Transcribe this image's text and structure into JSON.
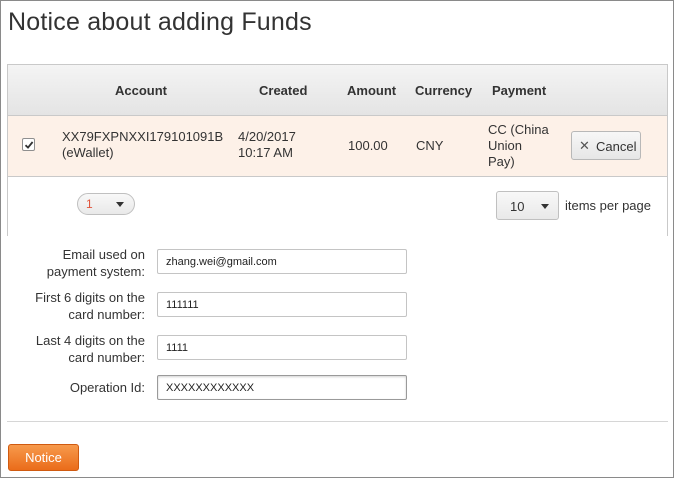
{
  "page": {
    "title": "Notice about adding Funds"
  },
  "grid": {
    "columns": [
      "Account",
      "Created",
      "Amount",
      "Currency",
      "Payment"
    ],
    "rows": [
      {
        "checked": true,
        "account_line1": "XX79FXPNXXI179101091B",
        "account_line2": "(eWallet)",
        "created_line1": "4/20/2017",
        "created_line2": "10:17 AM",
        "amount": "100.00",
        "currency": "CNY",
        "payment_line1": "CC (China",
        "payment_line2": "Union",
        "payment_line3": "Pay)",
        "action_label": "Cancel",
        "action_icon": "close-icon"
      }
    ],
    "pager": {
      "current_page": "1",
      "page_size": "10",
      "page_size_label": "items per page"
    }
  },
  "form": {
    "email": {
      "label_line1": "Email used on",
      "label_line2": "payment system:",
      "value": "zhang.wei@gmail.com"
    },
    "first6": {
      "label_line1": "First 6 digits on the",
      "label_line2": "card number:",
      "value": "111111"
    },
    "last4": {
      "label_line1": "Last 4 digits on the",
      "label_line2": "card number:",
      "value": "1111"
    },
    "operation_id": {
      "label": "Operation Id:",
      "value": "XXXXXXXXXXXX"
    }
  },
  "actions": {
    "submit_label": "Notice"
  },
  "colors": {
    "accent": "#ee7424",
    "selected_row": "#fdf1e8",
    "page_number": "#e0543c"
  }
}
